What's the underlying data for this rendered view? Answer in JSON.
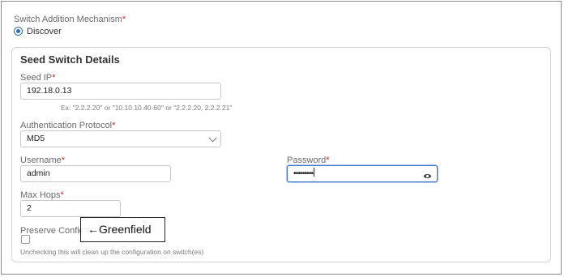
{
  "mechanism": {
    "label": "Switch Addition Mechanism",
    "required_mark": "*",
    "option": "Discover",
    "selected": true
  },
  "seed": {
    "title": "Seed Switch Details",
    "ip": {
      "label": "Seed IP",
      "required_mark": "*",
      "value": "192.18.0.13",
      "hint": "Ex: \"2.2.2.20\" or \"10.10.10.40-60\" or \"2.2.2.20, 2.2.2.21\""
    },
    "auth": {
      "label": "Authentication Protocol",
      "required_mark": "*",
      "value": "MD5"
    },
    "username": {
      "label": "Username",
      "required_mark": "*",
      "value": "admin"
    },
    "password": {
      "label": "Password",
      "required_mark": "*",
      "masked_value": "•••••••••",
      "toggle_icon": "eye-icon"
    },
    "max_hops": {
      "label": "Max Hops",
      "required_mark": "*",
      "value": "2"
    },
    "preserve": {
      "label": "Preserve Config",
      "checked": false,
      "hint": "Unchecking this will clean up the configuration on switch(es)"
    }
  },
  "annotation": {
    "arrow": "←",
    "text": "Greenfield"
  },
  "colors": {
    "accent": "#2e6fb7",
    "required": "#d0271d",
    "focus_border": "#3f78c8"
  }
}
